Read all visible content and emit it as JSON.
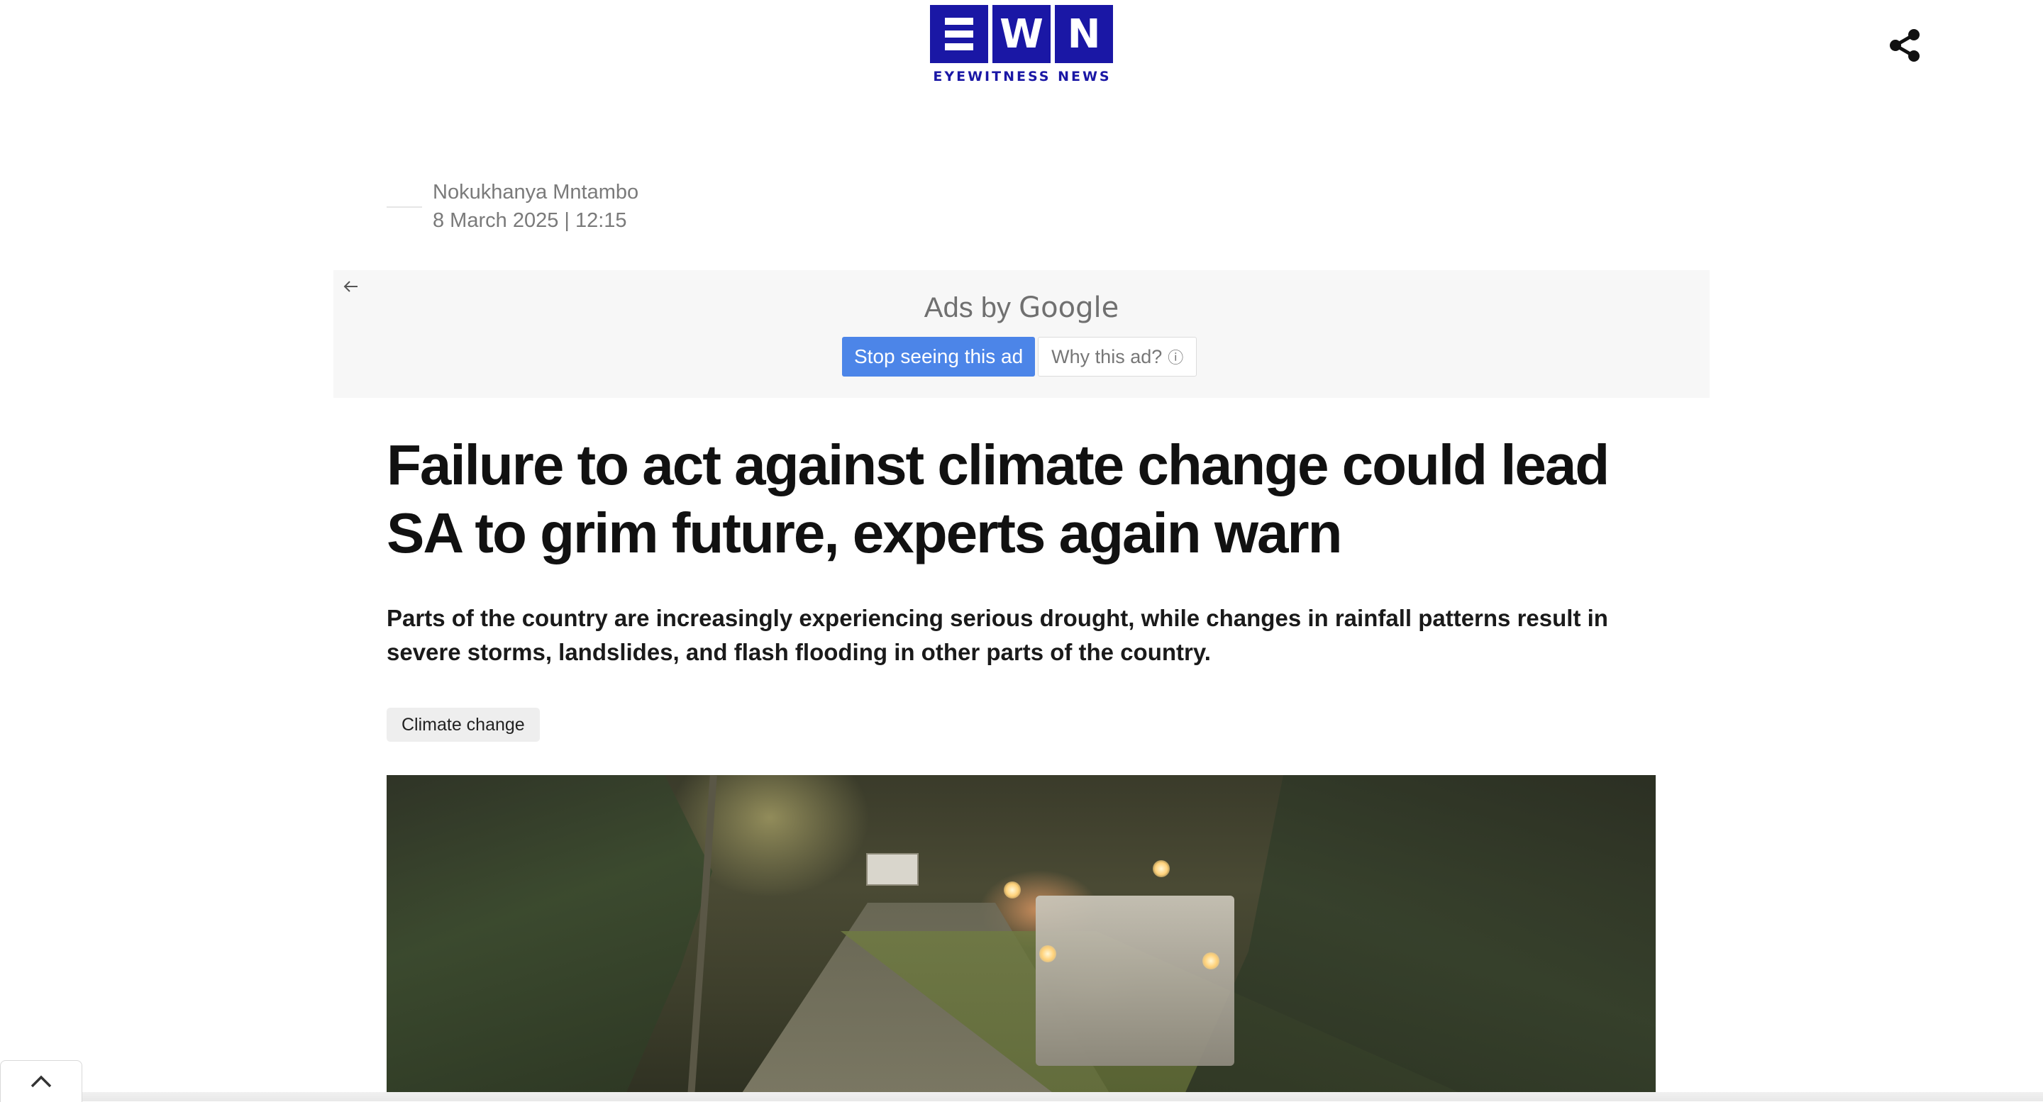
{
  "header": {
    "logo_letters": [
      "W",
      "N"
    ],
    "logo_text": "EYEWITNESS NEWS"
  },
  "author": {
    "name": "Nokukhanya Mntambo",
    "date": "8 March 2025 | 12:15"
  },
  "ad": {
    "title_prefix": "Ads by ",
    "title_brand": "Google",
    "stop_label": "Stop seeing this ad",
    "why_label": "Why this ad?",
    "info_glyph": "ⓘ"
  },
  "article": {
    "headline": "Failure to act against climate change could lead SA to grim future, experts again warn",
    "lede": "Parts of the country are increasingly experiencing serious drought, while changes in rainfall patterns result in severe storms, landslides, and flash flooding in other parts of the country.",
    "tag": "Climate change"
  },
  "icons": {
    "share": "share-icon",
    "back": "arrow-left-icon",
    "scroll_up": "chevron-up-icon"
  },
  "colors": {
    "brand": "#1a17a5",
    "ad_button": "#4c85e8"
  }
}
